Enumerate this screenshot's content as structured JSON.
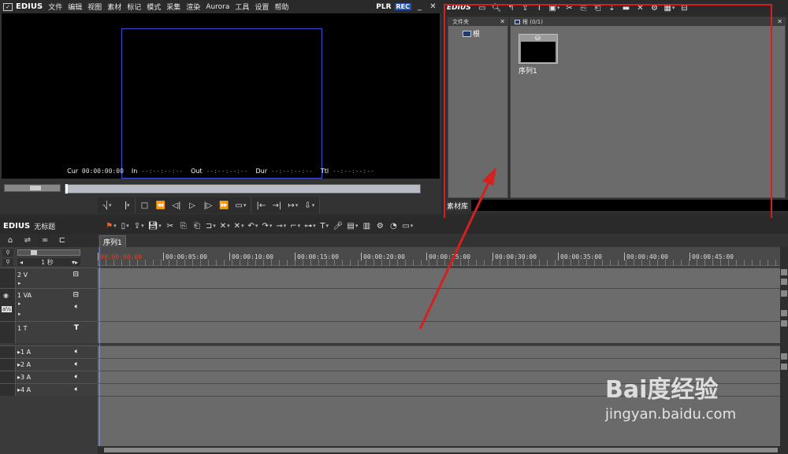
{
  "player": {
    "app_logo": "EDIUS",
    "menu": [
      "文件",
      "编辑",
      "视图",
      "素材",
      "标记",
      "模式",
      "采集",
      "渲染",
      "Aurora",
      "工具",
      "设置",
      "帮助"
    ],
    "plr": "PLR",
    "rec": "REC",
    "timecodes": {
      "cur_label": "Cur",
      "cur_value": "00:00:00:00",
      "in_label": "In",
      "in_value": "--:--:--:--",
      "out_label": "Out",
      "out_value": "--:--:--:--",
      "dur_label": "Dur",
      "dur_value": "--:--:--:--",
      "ttl_label": "Ttl",
      "ttl_value": "--:--:--:--"
    }
  },
  "bin": {
    "logo": "EDIUS",
    "folder_panel_title": "文件夹",
    "folder_root": "根",
    "clip_panel_title": "根 (0/1)",
    "clip_name": "序列1",
    "footer_tab": "素材库"
  },
  "timeline": {
    "logo": "EDIUS",
    "project_title": "无标题",
    "sequence_tab": "序列1",
    "scale": "1 秒",
    "ruler_ticks": [
      "00:00:00:00",
      "00:00:05:00",
      "00:00:10:00",
      "00:00:15:00",
      "00:00:20:00",
      "00:00:25:00",
      "00:00:30:00",
      "00:00:35:00",
      "00:00:40:00",
      "00:00:45:00"
    ],
    "tracks": [
      {
        "label": "2 V"
      },
      {
        "label": "1 VA"
      },
      {
        "label": "1 T"
      },
      {
        "label": "1 A"
      },
      {
        "label": "2 A"
      },
      {
        "label": "3 A"
      },
      {
        "label": "4 A"
      }
    ]
  },
  "watermark": {
    "brand": "Bai度经验",
    "site": "jingyan.baidu.com"
  },
  "colors": {
    "annotation_red": "#d42020",
    "rec_blue": "#2850b0",
    "safe_frame_blue": "#3a4ed8",
    "timecode_red": "#e04020"
  }
}
